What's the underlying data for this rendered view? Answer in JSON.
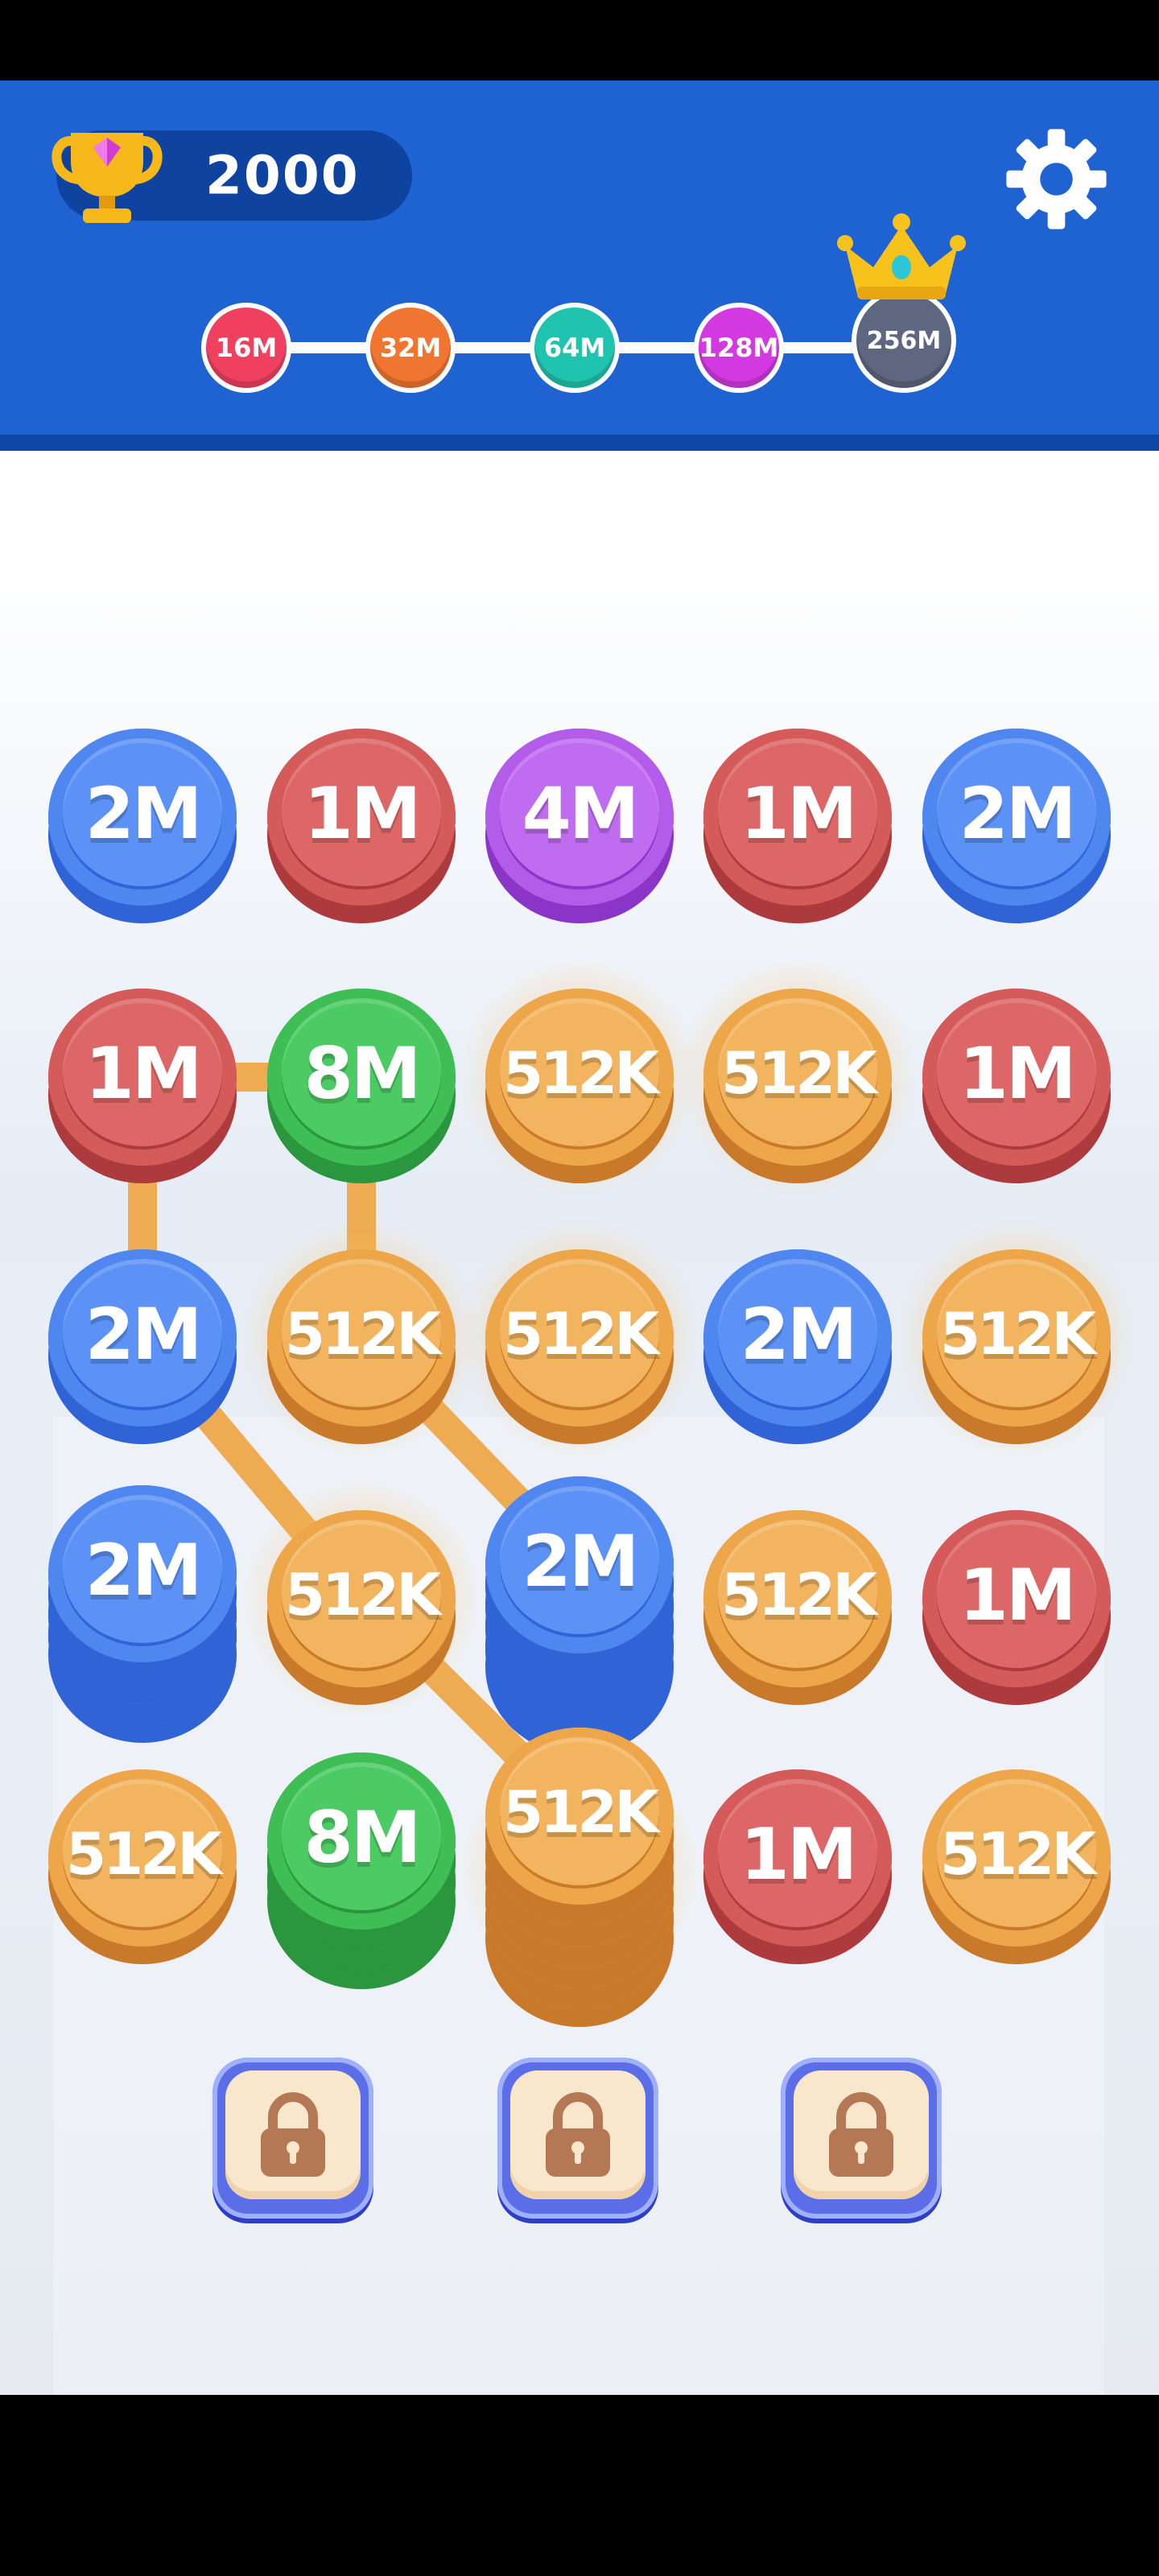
{
  "header": {
    "score": "2000",
    "milestones": [
      {
        "label": "16M",
        "color": "#f04060"
      },
      {
        "label": "32M",
        "color": "#f07530"
      },
      {
        "label": "64M",
        "color": "#20c3ad"
      },
      {
        "label": "128M",
        "color": "#d339e0"
      },
      {
        "label": "256M",
        "color": "#5f6780"
      }
    ],
    "icons": {
      "trophy": "trophy-icon",
      "settings": "gear-icon",
      "crown": "crown-icon"
    }
  },
  "board": {
    "columns": 5,
    "rows": 5,
    "cells": [
      [
        {
          "label": "2M",
          "color": "blue",
          "stack": 1
        },
        {
          "label": "1M",
          "color": "red",
          "stack": 1
        },
        {
          "label": "4M",
          "color": "purple",
          "stack": 1
        },
        {
          "label": "1M",
          "color": "red",
          "stack": 1
        },
        {
          "label": "2M",
          "color": "blue",
          "stack": 1
        }
      ],
      [
        {
          "label": "1M",
          "color": "red",
          "stack": 1
        },
        {
          "label": "8M",
          "color": "green",
          "stack": 1
        },
        {
          "label": "512K",
          "color": "orange",
          "stack": 1,
          "selected": true
        },
        {
          "label": "512K",
          "color": "orange",
          "stack": 1,
          "selected": true
        },
        {
          "label": "1M",
          "color": "red",
          "stack": 1
        }
      ],
      [
        {
          "label": "2M",
          "color": "blue",
          "stack": 1
        },
        {
          "label": "512K",
          "color": "orange",
          "stack": 1,
          "selected": true
        },
        {
          "label": "512K",
          "color": "orange",
          "stack": 1,
          "selected": true
        },
        {
          "label": "2M",
          "color": "blue",
          "stack": 1
        },
        {
          "label": "512K",
          "color": "orange",
          "stack": 1,
          "selected": true
        }
      ],
      [
        {
          "label": "2M",
          "color": "blue",
          "stack": 4
        },
        {
          "label": "512K",
          "color": "orange",
          "stack": 1,
          "selected": true
        },
        {
          "label": "2M",
          "color": "blue",
          "stack": 5
        },
        {
          "label": "512K",
          "color": "orange",
          "stack": 1
        },
        {
          "label": "1M",
          "color": "red",
          "stack": 1
        }
      ],
      [
        {
          "label": "512K",
          "color": "orange",
          "stack": 1
        },
        {
          "label": "8M",
          "color": "green",
          "stack": 3
        },
        {
          "label": "512K",
          "color": "orange",
          "stack": 6,
          "selected": true
        },
        {
          "label": "1M",
          "color": "red",
          "stack": 1
        },
        {
          "label": "512K",
          "color": "orange",
          "stack": 1
        }
      ]
    ],
    "selection_path": [
      [
        2,
        4
      ],
      [
        2,
        3
      ],
      [
        1,
        2
      ],
      [
        1,
        1
      ],
      [
        0,
        1
      ],
      [
        0,
        2
      ],
      [
        1,
        3
      ],
      [
        2,
        4
      ]
    ]
  },
  "locked_slots": [
    {
      "icon": "lock-icon"
    },
    {
      "icon": "lock-icon"
    },
    {
      "icon": "lock-icon"
    }
  ],
  "palette": {
    "blue": {
      "top": "#4f86ef",
      "bottom": "#2f63d6",
      "inner": "#5c92f5"
    },
    "red": {
      "top": "#d55a5a",
      "bottom": "#ad3b3e",
      "inner": "#dd6767"
    },
    "purple": {
      "top": "#b45cea",
      "bottom": "#8b34c8",
      "inner": "#bf6cf0"
    },
    "green": {
      "top": "#3fbe56",
      "bottom": "#2a963d",
      "inner": "#4cca63"
    },
    "orange": {
      "top": "#eea64a",
      "bottom": "#c9792a",
      "inner": "#f2b45f"
    }
  }
}
